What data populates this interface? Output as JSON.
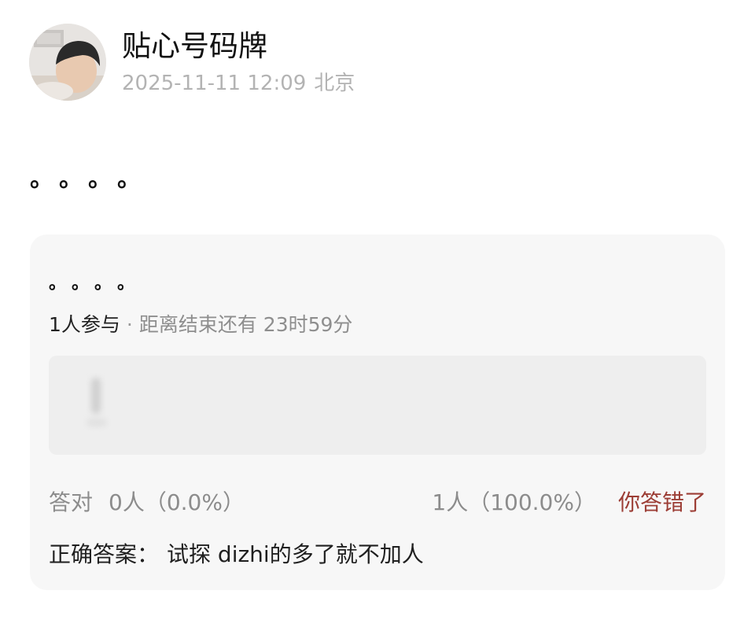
{
  "post": {
    "author": "贴心号码牌",
    "timestamp": "2025-11-11 12:09",
    "location": "北京",
    "avatar_icon": "user-avatar-photo",
    "body": "。。。。"
  },
  "quiz": {
    "title": "。。。。",
    "participants": "1人参与",
    "separator": "·",
    "countdown": "距离结束还有 23时59分",
    "correct_label": "答对",
    "correct_count": "0人（0.0%）",
    "wrong_count": "1人（100.0%）",
    "wrong_label": "你答错了",
    "answer_label": "正确答案：",
    "answer_text": "试探 dizhi的多了就不加人"
  },
  "colors": {
    "card_background": "#f7f7f7",
    "option_background": "#eeeeee",
    "meta_text": "#b3b3b3",
    "wrong_text": "#9c3d35"
  }
}
